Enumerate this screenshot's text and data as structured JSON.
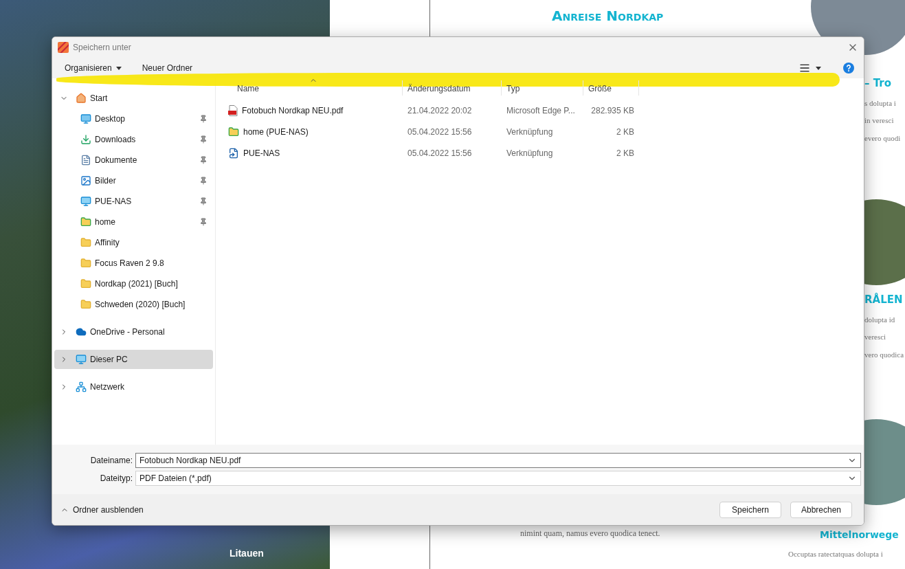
{
  "background": {
    "map_label": "Litauen",
    "document": {
      "heading": "Anreise Nordkap",
      "side_blocks": [
        {
          "heading": "– Tro",
          "lines": [
            "s dolupta i",
            "in veresci",
            "evero quodi"
          ]
        },
        {
          "heading": "RÅLEN",
          "lines": [
            "dolupta id",
            "veresci",
            "vero quodica"
          ]
        }
      ],
      "bottom_heading": "Mittelnorwege",
      "bottom_text": "nimint quam, namus evero quodica tenect.",
      "bottom_right_text": "Occuptas ratectatquas dolupta i"
    }
  },
  "dialog": {
    "title": "Speichern unter",
    "toolbar": {
      "organize": "Organisieren",
      "new_folder": "Neuer Ordner"
    },
    "nav": [
      {
        "label": "Start",
        "kind": "home",
        "expanded": true,
        "selected": false,
        "children": [
          {
            "label": "Desktop",
            "kind": "desktop",
            "pinned": true,
            "selected": false
          },
          {
            "label": "Downloads",
            "kind": "download",
            "pinned": true,
            "selected": false
          },
          {
            "label": "Dokumente",
            "kind": "document",
            "pinned": true,
            "selected": false
          },
          {
            "label": "Bilder",
            "kind": "picture",
            "pinned": true,
            "selected": false
          },
          {
            "label": "PUE-NAS",
            "kind": "monitor",
            "pinned": true,
            "selected": false
          },
          {
            "label": "home",
            "kind": "folder-green",
            "pinned": true,
            "selected": false
          },
          {
            "label": "Affinity",
            "kind": "folder",
            "pinned": false,
            "selected": false
          },
          {
            "label": "Focus Raven 2 9.8",
            "kind": "folder",
            "pinned": false,
            "selected": false
          },
          {
            "label": "Nordkap (2021) [Buch]",
            "kind": "folder",
            "pinned": false,
            "selected": false
          },
          {
            "label": "Schweden (2020) [Buch]",
            "kind": "folder",
            "pinned": false,
            "selected": false
          }
        ]
      },
      {
        "label": "OneDrive - Personal",
        "kind": "cloud",
        "expanded": false,
        "selected": false
      },
      {
        "label": "Dieser PC",
        "kind": "monitor",
        "expanded": false,
        "selected": true
      },
      {
        "label": "Netzwerk",
        "kind": "network",
        "expanded": false,
        "selected": false
      }
    ],
    "columns": [
      {
        "label": "Name",
        "sorted": true
      },
      {
        "label": "Änderungsdatum",
        "sorted": false
      },
      {
        "label": "Typ",
        "sorted": false
      },
      {
        "label": "Größe",
        "sorted": false
      }
    ],
    "files": [
      {
        "name": "Fotobuch Nordkap NEU.pdf",
        "date": "21.04.2022 20:02",
        "type": "Microsoft Edge P...",
        "size": "282.935 KB",
        "kind": "pdf"
      },
      {
        "name": "home (PUE-NAS)",
        "date": "05.04.2022 15:56",
        "type": "Verknüpfung",
        "size": "2 KB",
        "kind": "folder-link"
      },
      {
        "name": "PUE-NAS",
        "date": "05.04.2022 15:56",
        "type": "Verknüpfung",
        "size": "2 KB",
        "kind": "network-link"
      }
    ],
    "filename": {
      "label": "Dateiname:",
      "value": "Fotobuch Nordkap NEU.pdf"
    },
    "filetype": {
      "label": "Dateityp:",
      "value": "PDF Dateien (*.pdf)"
    },
    "hide_folders": "Ordner ausblenden",
    "buttons": [
      {
        "label": "Speichern"
      },
      {
        "label": "Abbrechen"
      }
    ]
  }
}
